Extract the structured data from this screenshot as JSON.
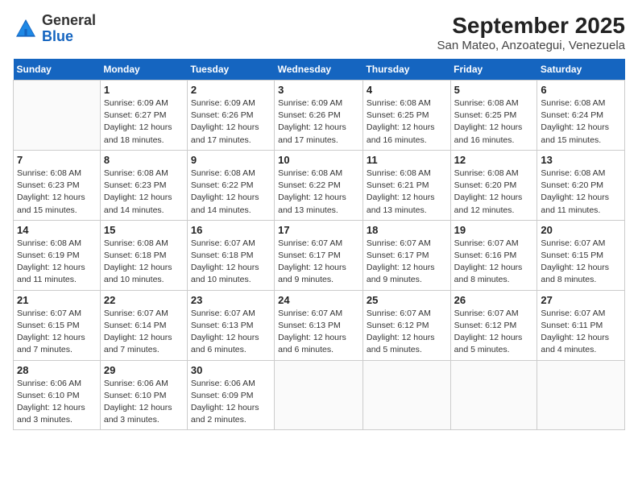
{
  "logo": {
    "general": "General",
    "blue": "Blue"
  },
  "title": "September 2025",
  "subtitle": "San Mateo, Anzoategui, Venezuela",
  "weekdays": [
    "Sunday",
    "Monday",
    "Tuesday",
    "Wednesday",
    "Thursday",
    "Friday",
    "Saturday"
  ],
  "weeks": [
    [
      {
        "day": null
      },
      {
        "day": "1",
        "sunrise": "6:09 AM",
        "sunset": "6:27 PM",
        "daylight": "12 hours and 18 minutes."
      },
      {
        "day": "2",
        "sunrise": "6:09 AM",
        "sunset": "6:26 PM",
        "daylight": "12 hours and 17 minutes."
      },
      {
        "day": "3",
        "sunrise": "6:09 AM",
        "sunset": "6:26 PM",
        "daylight": "12 hours and 17 minutes."
      },
      {
        "day": "4",
        "sunrise": "6:08 AM",
        "sunset": "6:25 PM",
        "daylight": "12 hours and 16 minutes."
      },
      {
        "day": "5",
        "sunrise": "6:08 AM",
        "sunset": "6:25 PM",
        "daylight": "12 hours and 16 minutes."
      },
      {
        "day": "6",
        "sunrise": "6:08 AM",
        "sunset": "6:24 PM",
        "daylight": "12 hours and 15 minutes."
      }
    ],
    [
      {
        "day": "7",
        "sunrise": "6:08 AM",
        "sunset": "6:23 PM",
        "daylight": "12 hours and 15 minutes."
      },
      {
        "day": "8",
        "sunrise": "6:08 AM",
        "sunset": "6:23 PM",
        "daylight": "12 hours and 14 minutes."
      },
      {
        "day": "9",
        "sunrise": "6:08 AM",
        "sunset": "6:22 PM",
        "daylight": "12 hours and 14 minutes."
      },
      {
        "day": "10",
        "sunrise": "6:08 AM",
        "sunset": "6:22 PM",
        "daylight": "12 hours and 13 minutes."
      },
      {
        "day": "11",
        "sunrise": "6:08 AM",
        "sunset": "6:21 PM",
        "daylight": "12 hours and 13 minutes."
      },
      {
        "day": "12",
        "sunrise": "6:08 AM",
        "sunset": "6:20 PM",
        "daylight": "12 hours and 12 minutes."
      },
      {
        "day": "13",
        "sunrise": "6:08 AM",
        "sunset": "6:20 PM",
        "daylight": "12 hours and 11 minutes."
      }
    ],
    [
      {
        "day": "14",
        "sunrise": "6:08 AM",
        "sunset": "6:19 PM",
        "daylight": "12 hours and 11 minutes."
      },
      {
        "day": "15",
        "sunrise": "6:08 AM",
        "sunset": "6:18 PM",
        "daylight": "12 hours and 10 minutes."
      },
      {
        "day": "16",
        "sunrise": "6:07 AM",
        "sunset": "6:18 PM",
        "daylight": "12 hours and 10 minutes."
      },
      {
        "day": "17",
        "sunrise": "6:07 AM",
        "sunset": "6:17 PM",
        "daylight": "12 hours and 9 minutes."
      },
      {
        "day": "18",
        "sunrise": "6:07 AM",
        "sunset": "6:17 PM",
        "daylight": "12 hours and 9 minutes."
      },
      {
        "day": "19",
        "sunrise": "6:07 AM",
        "sunset": "6:16 PM",
        "daylight": "12 hours and 8 minutes."
      },
      {
        "day": "20",
        "sunrise": "6:07 AM",
        "sunset": "6:15 PM",
        "daylight": "12 hours and 8 minutes."
      }
    ],
    [
      {
        "day": "21",
        "sunrise": "6:07 AM",
        "sunset": "6:15 PM",
        "daylight": "12 hours and 7 minutes."
      },
      {
        "day": "22",
        "sunrise": "6:07 AM",
        "sunset": "6:14 PM",
        "daylight": "12 hours and 7 minutes."
      },
      {
        "day": "23",
        "sunrise": "6:07 AM",
        "sunset": "6:13 PM",
        "daylight": "12 hours and 6 minutes."
      },
      {
        "day": "24",
        "sunrise": "6:07 AM",
        "sunset": "6:13 PM",
        "daylight": "12 hours and 6 minutes."
      },
      {
        "day": "25",
        "sunrise": "6:07 AM",
        "sunset": "6:12 PM",
        "daylight": "12 hours and 5 minutes."
      },
      {
        "day": "26",
        "sunrise": "6:07 AM",
        "sunset": "6:12 PM",
        "daylight": "12 hours and 5 minutes."
      },
      {
        "day": "27",
        "sunrise": "6:07 AM",
        "sunset": "6:11 PM",
        "daylight": "12 hours and 4 minutes."
      }
    ],
    [
      {
        "day": "28",
        "sunrise": "6:06 AM",
        "sunset": "6:10 PM",
        "daylight": "12 hours and 3 minutes."
      },
      {
        "day": "29",
        "sunrise": "6:06 AM",
        "sunset": "6:10 PM",
        "daylight": "12 hours and 3 minutes."
      },
      {
        "day": "30",
        "sunrise": "6:06 AM",
        "sunset": "6:09 PM",
        "daylight": "12 hours and 2 minutes."
      },
      {
        "day": null
      },
      {
        "day": null
      },
      {
        "day": null
      },
      {
        "day": null
      }
    ]
  ]
}
